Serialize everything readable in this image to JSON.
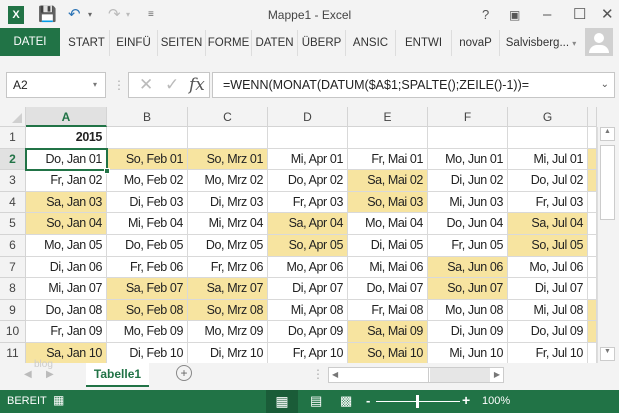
{
  "window": {
    "title": "Mappe1 - Excel"
  },
  "ribbon": {
    "tabs": [
      "DATEI",
      "START",
      "EINFÜ",
      "SEITEN",
      "FORME",
      "DATEN",
      "ÜBERP",
      "ANSIC",
      "ENTWI",
      "novaP"
    ],
    "user": "Salvisberg..."
  },
  "formula_bar": {
    "name_box": "A2",
    "formula": "=WENN(MONAT(DATUM($A$1;SPALTE();ZEILE()-1))="
  },
  "grid": {
    "columns": [
      "A",
      "B",
      "C",
      "D",
      "E",
      "F",
      "G"
    ],
    "row_numbers": [
      "1",
      "2",
      "3",
      "4",
      "5",
      "6",
      "7",
      "8",
      "9",
      "10",
      "11"
    ],
    "row1": [
      "2015"
    ],
    "rows": [
      [
        "Do, Jan 01",
        "So, Feb 01",
        "So, Mrz 01",
        "Mi, Apr 01",
        "Fr, Mai 01",
        "Mo, Jun 01",
        "Mi, Jul 01"
      ],
      [
        "Fr, Jan 02",
        "Mo, Feb 02",
        "Mo, Mrz 02",
        "Do, Apr 02",
        "Sa, Mai 02",
        "Di, Jun 02",
        "Do, Jul 02"
      ],
      [
        "Sa, Jan 03",
        "Di, Feb 03",
        "Di, Mrz 03",
        "Fr, Apr 03",
        "So, Mai 03",
        "Mi, Jun 03",
        "Fr, Jul 03"
      ],
      [
        "So, Jan 04",
        "Mi, Feb 04",
        "Mi, Mrz 04",
        "Sa, Apr 04",
        "Mo, Mai 04",
        "Do, Jun 04",
        "Sa, Jul 04"
      ],
      [
        "Mo, Jan 05",
        "Do, Feb 05",
        "Do, Mrz 05",
        "So, Apr 05",
        "Di, Mai 05",
        "Fr, Jun 05",
        "So, Jul 05"
      ],
      [
        "Di, Jan 06",
        "Fr, Feb 06",
        "Fr, Mrz 06",
        "Mo, Apr 06",
        "Mi, Mai 06",
        "Sa, Jun 06",
        "Mo, Jul 06"
      ],
      [
        "Mi, Jan 07",
        "Sa, Feb 07",
        "Sa, Mrz 07",
        "Di, Apr 07",
        "Do, Mai 07",
        "So, Jun 07",
        "Di, Jul 07"
      ],
      [
        "Do, Jan 08",
        "So, Feb 08",
        "So, Mrz 08",
        "Mi, Apr 08",
        "Fr, Mai 08",
        "Mo, Jun 08",
        "Mi, Jul 08"
      ],
      [
        "Fr, Jan 09",
        "Mo, Feb 09",
        "Mo, Mrz 09",
        "Do, Apr 09",
        "Sa, Mai 09",
        "Di, Jun 09",
        "Do, Jul 09"
      ],
      [
        "Sa, Jan 10",
        "Di, Feb 10",
        "Di, Mrz 10",
        "Fr, Apr 10",
        "So, Mai 10",
        "Mi, Jun 10",
        "Fr, Jul 10"
      ]
    ],
    "partial_col_weekend": [
      true,
      true,
      false,
      false,
      false,
      false,
      false,
      true,
      true,
      false
    ]
  },
  "sheets": {
    "active": "Tabelle1",
    "watermark": "blog"
  },
  "status": {
    "text": "BEREIT",
    "zoom": "100%"
  },
  "colors": {
    "accent": "#217346",
    "weekend": "#f7e4a0"
  }
}
